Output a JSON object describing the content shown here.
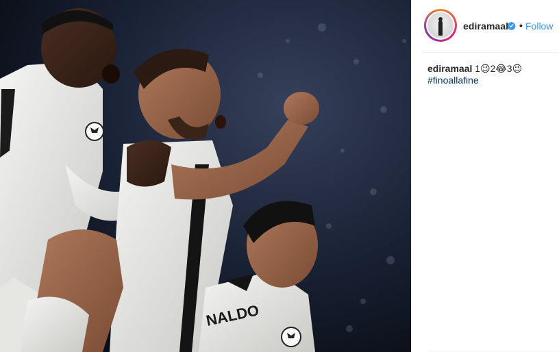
{
  "post": {
    "username": "ediramaal",
    "follow_label": "Follow",
    "separator": "•",
    "caption_user": "ediramaal",
    "caption_text": "1😉2😂3😉",
    "hashtag": "#finoallafine"
  },
  "colors": {
    "link_blue": "#3897f0",
    "hashtag_blue": "#003569",
    "text": "#262626",
    "verified_badge": "#3897f0"
  },
  "icons": {
    "verified": "verified-badge-icon",
    "avatar": "profile-avatar"
  }
}
